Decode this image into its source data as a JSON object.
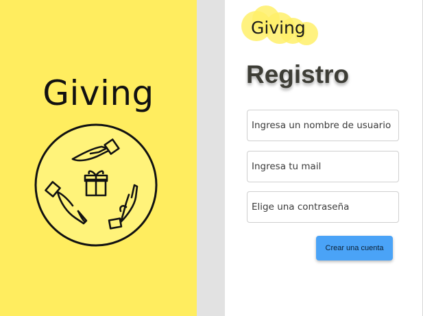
{
  "colors": {
    "hero_background": "#ffed5f",
    "accent_button": "#4aa3f7",
    "gutter": "#e2e2e2"
  },
  "hero": {
    "title": "Giving",
    "emblem_icon": "hands-gift-icon"
  },
  "brand": {
    "name": "Giving"
  },
  "form": {
    "title": "Registro",
    "username_placeholder": "Ingresa un nombre de usuario",
    "email_placeholder": "Ingresa tu mail",
    "password_placeholder": "Elige una contraseña",
    "submit_label": "Crear una cuenta"
  }
}
